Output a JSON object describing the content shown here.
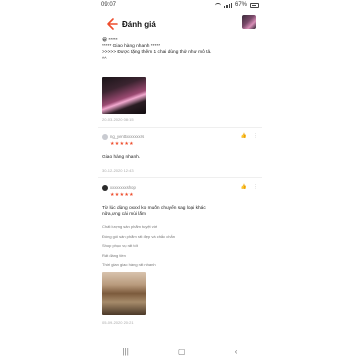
{
  "status": {
    "time": "09:07",
    "battery": "67%"
  },
  "header": {
    "title": "Đánh giá"
  },
  "review1": {
    "line1": "😁 *****",
    "line2": "***** Giao hàng nhanh *****",
    "line3": ">>>>> Được tặng thêm 1 chai dùng thử như mô tả.",
    "line4": "^^",
    "date": "20-03-2020 08:15"
  },
  "review2": {
    "username": "ng_yenttxxxxxxxrs",
    "stars": "★★★★★",
    "text": "Giao hàng nhanh.",
    "date": "30-12-2020 12:43"
  },
  "review3": {
    "username": "xxxxxxxxshop",
    "stars": "★★★★★",
    "text_line1": "Từ lúc dùng oxxxl ko muốn chuyển sag loại khác",
    "text_line2": "nữa,ưng cái mùi lắm",
    "tags": [
      "Chất lượng sản phẩm tuyệt vời",
      "Đóng gói sản phẩm rất đẹp và chắc chắn",
      "Shop phục vụ rất tốt",
      "Rất đáng tiền",
      "Thời gian giao hàng rất nhanh"
    ],
    "date": "05-09-2020 20:21"
  },
  "colors": {
    "accent": "#ee4d2d"
  },
  "icons": [
    "back-arrow-icon",
    "like-icon",
    "more-icon",
    "recent-apps-icon",
    "home-icon",
    "back-nav-icon"
  ]
}
